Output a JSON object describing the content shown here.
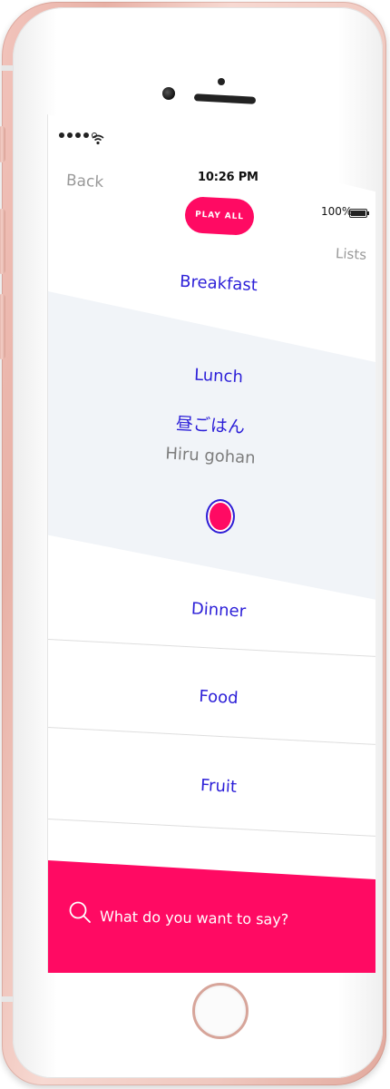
{
  "status_bar": {
    "time": "10:26 PM",
    "battery": "100%"
  },
  "nav": {
    "back_label": "Back",
    "lists_label": "Lists",
    "play_all_label": "PLAY ALL"
  },
  "words": [
    {
      "label": "Breakfast"
    },
    {
      "label": "Lunch",
      "expanded": true,
      "japanese": "昼ごはん",
      "romaji": "Hiru gohan"
    },
    {
      "label": "Dinner"
    },
    {
      "label": "Food"
    },
    {
      "label": "Fruit"
    }
  ],
  "search": {
    "placeholder": "What do you want to say?"
  },
  "colors": {
    "accent": "#ff0a63",
    "word_text": "#2c1fd8",
    "secondary_text": "#7d7d7d",
    "expanded_bg": "#f1f4f8"
  }
}
